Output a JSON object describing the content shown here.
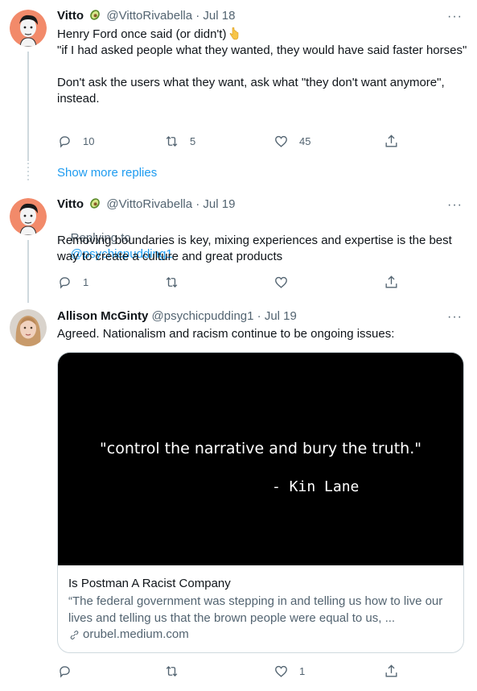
{
  "tweets": [
    {
      "name": "Vitto",
      "handle": "@VittoRivabella",
      "date": "Jul 18",
      "text_line1": "Henry Ford once said (or didn't)",
      "text_rest": "\"if I had asked people what they wanted, they would have said faster horses\"\n\nDon't ask the users what they want, ask what \"they don't want anymore\", instead.",
      "reply_count": "10",
      "retweet_count": "5",
      "like_count": "45"
    },
    {
      "name": "Vitto",
      "handle": "@VittoRivabella",
      "date": "Jul 19",
      "replying_label": "Replying to",
      "replying_handle": "@psychicpudding1",
      "text": "Removing boundaries is key, mixing experiences and expertise is the best way to create a culture and great products",
      "reply_count": "1",
      "retweet_count": "",
      "like_count": ""
    },
    {
      "name": "Allison McGinty",
      "handle": "@psychicpudding1",
      "date": "Jul 19",
      "text": "Agreed. Nationalism and racism continue to be ongoing issues:",
      "reply_count": "",
      "retweet_count": "",
      "like_count": "1",
      "card": {
        "quote": "\"control the narrative and bury the truth.\"",
        "attribution": "- Kin Lane",
        "title": "Is Postman A Racist Company",
        "description": "“The federal government was stepping in and telling us how to live our lives and telling us that the brown people were equal to us, ...",
        "domain": "orubel.medium.com"
      }
    }
  ],
  "show_more_replies": "Show more replies",
  "separator": "·",
  "more_glyph": "···",
  "colors": {
    "link": "#1d9bf0",
    "muted": "#536471",
    "text": "#0f1419",
    "line": "#cfd9de"
  },
  "icons": [
    "avocado-emoji",
    "pointing-down-emoji",
    "reply-icon",
    "retweet-icon",
    "like-icon",
    "share-icon",
    "more-icon",
    "link-icon"
  ]
}
